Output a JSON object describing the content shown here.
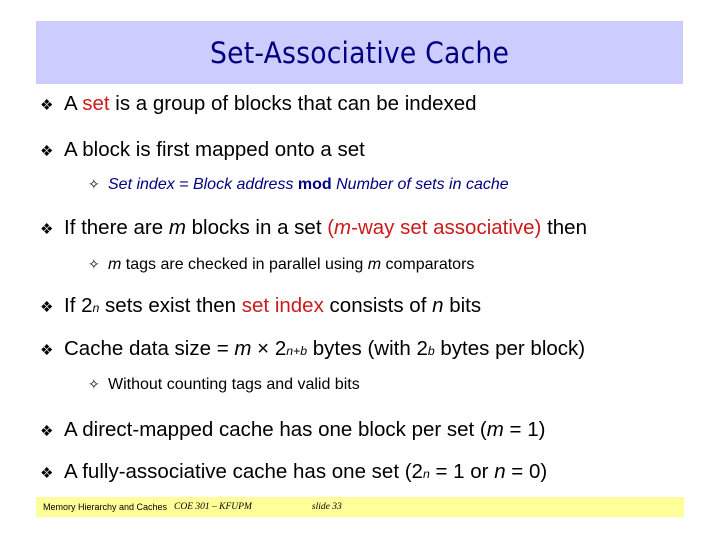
{
  "title": "Set-Associative Cache",
  "colors": {
    "title_bg": "#ccccff",
    "title_text": "#000080",
    "highlight_red": "#cc1a1a",
    "subbullet_blue": "#000080",
    "footer_bg": "#ffff99"
  },
  "icons": {
    "bullet_level1": "diamond-cluster-icon",
    "bullet_level2": "four-point-star-icon"
  },
  "bullets": [
    {
      "level": 1,
      "parts": [
        "A ",
        "set",
        " is a group of blocks that can be indexed"
      ]
    },
    {
      "level": 1,
      "parts": [
        "A block is first mapped onto a set"
      ]
    },
    {
      "level": 2,
      "parts": [
        "Set index = Block address ",
        "mod",
        " Number of sets in cache"
      ]
    },
    {
      "level": 1,
      "parts": [
        "If there are ",
        "m",
        " blocks in a set ",
        "(",
        "m",
        "-way set associative)",
        " then"
      ]
    },
    {
      "level": 2,
      "parts": [
        "m",
        " tags are checked in parallel using ",
        "m",
        " comparators"
      ]
    },
    {
      "level": 1,
      "parts": [
        "If 2",
        "n",
        " sets exist then ",
        "set index",
        " consists of ",
        "n",
        " bits"
      ]
    },
    {
      "level": 1,
      "parts": [
        "Cache data size = ",
        "m",
        " × 2",
        "n+b",
        " bytes (with 2",
        "b",
        " bytes per block)"
      ]
    },
    {
      "level": 2,
      "parts": [
        "Without counting tags and valid bits"
      ]
    },
    {
      "level": 1,
      "parts": [
        "A direct-mapped cache has one block per set (",
        "m",
        " = 1)"
      ]
    },
    {
      "level": 1,
      "parts": [
        "A fully-associative cache has one set (2",
        "n",
        " = 1 or ",
        "n",
        " = 0)"
      ]
    }
  ],
  "footer": {
    "course_title": "Memory Hierarchy and Caches",
    "course_code": "COE 301 – KFUPM",
    "slide_label": "slide 33"
  }
}
